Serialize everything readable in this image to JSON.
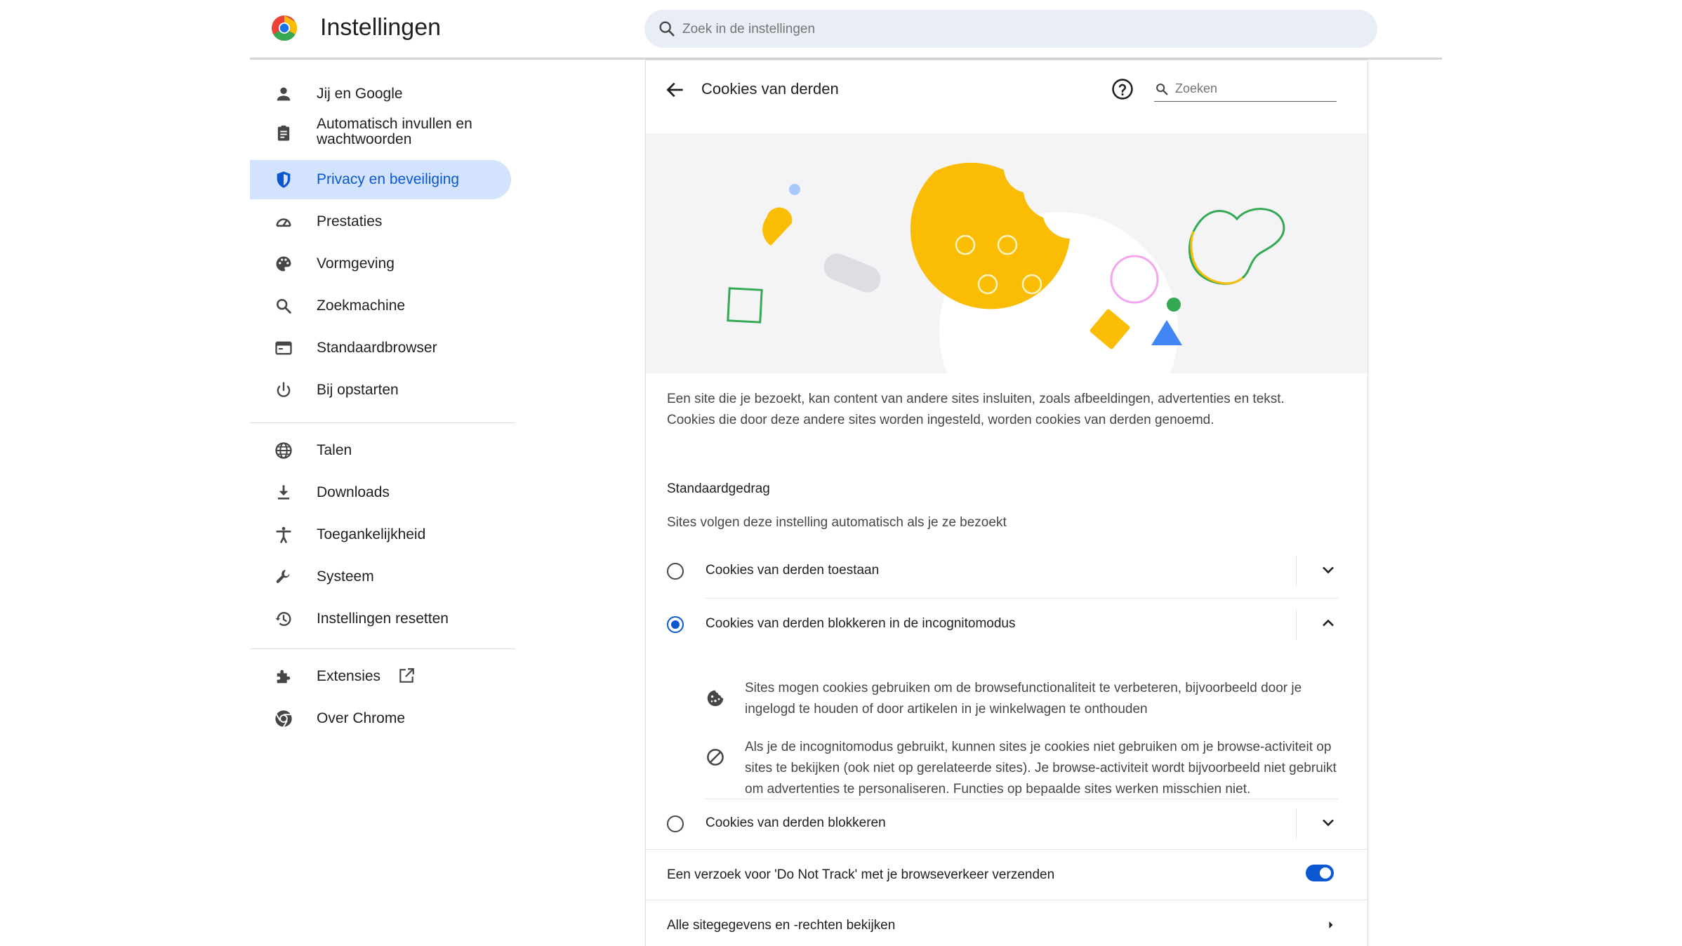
{
  "app": {
    "title": "Instellingen",
    "logo_icon": "chrome-logo"
  },
  "search": {
    "placeholder": "Zoek in de instellingen"
  },
  "sidebar": {
    "items": [
      {
        "label": "Jij en Google",
        "icon": "person-icon"
      },
      {
        "label": "Automatisch invullen en wachtwoorden",
        "icon": "clipboard-icon"
      },
      {
        "label": "Privacy en beveiliging",
        "icon": "shield-icon",
        "active": true
      },
      {
        "label": "Prestaties",
        "icon": "speedometer-icon"
      },
      {
        "label": "Vormgeving",
        "icon": "palette-icon"
      },
      {
        "label": "Zoekmachine",
        "icon": "search-icon"
      },
      {
        "label": "Standaardbrowser",
        "icon": "browser-window-icon"
      },
      {
        "label": "Bij opstarten",
        "icon": "power-icon"
      },
      {
        "label": "Talen",
        "icon": "globe-icon"
      },
      {
        "label": "Downloads",
        "icon": "download-icon"
      },
      {
        "label": "Toegankelijkheid",
        "icon": "accessibility-icon"
      },
      {
        "label": "Systeem",
        "icon": "wrench-icon"
      },
      {
        "label": "Instellingen resetten",
        "icon": "history-icon"
      },
      {
        "label": "Extensies",
        "icon": "puzzle-icon",
        "external": true
      },
      {
        "label": "Over Chrome",
        "icon": "chrome-icon"
      }
    ]
  },
  "page": {
    "title": "Cookies van derden",
    "search_placeholder": "Zoeken",
    "description_line1": "Een site die je bezoekt, kan content van andere sites insluiten, zoals afbeeldingen, advertenties en tekst.",
    "description_line2": "Cookies die door deze andere sites worden ingesteld, worden cookies van derden genoemd.",
    "section_title": "Standaardgedrag",
    "section_subtitle": "Sites volgen deze instelling automatisch als je ze bezoekt",
    "options": [
      {
        "label": "Cookies van derden toestaan",
        "selected": false,
        "expanded": false
      },
      {
        "label": "Cookies van derden blokkeren in de incognitomodus",
        "selected": true,
        "expanded": true
      },
      {
        "label": "Cookies van derden blokkeren",
        "selected": false,
        "expanded": false
      }
    ],
    "details": [
      {
        "icon": "cookie-icon",
        "text": "Sites mogen cookies gebruiken om de browsefunctionaliteit te verbeteren, bijvoorbeeld door je ingelogd te houden of door artikelen in je winkelwagen te onthouden"
      },
      {
        "icon": "block-icon",
        "text": "Als je de incognitomodus gebruikt, kunnen sites je cookies niet gebruiken om je browse-activiteit op sites te bekijken (ook niet op gerelateerde sites). Je browse-activiteit wordt bijvoorbeeld niet gebruikt om advertenties te personaliseren. Functies op bepaalde sites werken misschien niet."
      }
    ],
    "dnt_label": "Een verzoek voor 'Do Not Track' met je browseverkeer verzenden",
    "dnt_enabled": true,
    "site_data_link": "Alle sitegegevens en -rechten bekijken"
  },
  "colors": {
    "accent": "#0b57d0",
    "active_bg": "#d3e3fd",
    "cookie": "#fbbc04",
    "green": "#34a853",
    "pink": "#f3a6f0",
    "blue": "#4285f4"
  }
}
